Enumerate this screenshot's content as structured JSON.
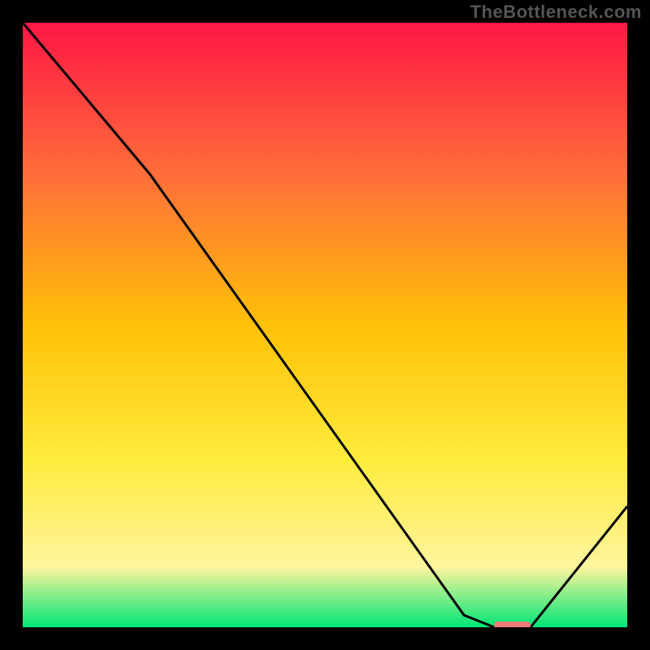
{
  "watermark": "TheBottleneck.com",
  "colors": {
    "background": "#000000",
    "gradient_top": "#ff1744",
    "gradient_upper_mid": "#ff6d3a",
    "gradient_mid": "#ffc107",
    "gradient_lower_mid": "#ffeb3b",
    "gradient_pale": "#fff59d",
    "gradient_bottom": "#00e676",
    "curve": "#000000",
    "marker": "#ec7b78"
  },
  "chart_data": {
    "type": "line",
    "title": "",
    "xlabel": "",
    "ylabel": "",
    "xlim": [
      0,
      100
    ],
    "ylim": [
      0,
      100
    ],
    "series": [
      {
        "name": "bottleneck-curve",
        "x": [
          0,
          21,
          73,
          78,
          84,
          100
        ],
        "y": [
          100,
          75,
          2,
          0,
          0,
          20
        ]
      }
    ],
    "marker": {
      "name": "optimal-range",
      "x_start": 78,
      "x_end": 84,
      "y": 0
    }
  }
}
